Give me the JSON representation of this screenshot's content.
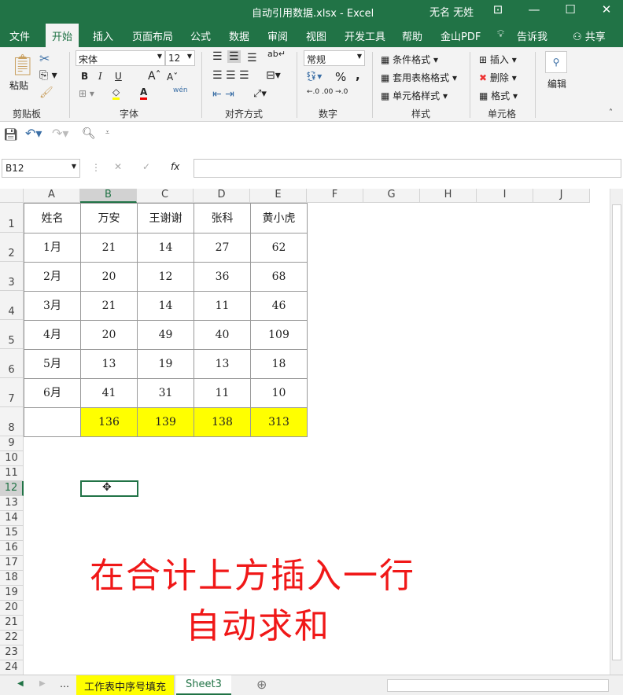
{
  "title": "自动引用数据.xlsx  -  Excel",
  "user": "无名 无姓",
  "menu_tabs": [
    "文件",
    "开始",
    "插入",
    "页面布局",
    "公式",
    "数据",
    "审阅",
    "视图",
    "开发工具",
    "帮助",
    "金山PDF",
    "告诉我",
    "共享"
  ],
  "ribbon": {
    "paste": "粘贴",
    "clipboard": "剪贴板",
    "font_name": "宋体",
    "font_size": "12",
    "bold": "B",
    "italic": "I",
    "underline": "U",
    "font_group": "字体",
    "phonetic": "wén",
    "align_group": "对齐方式",
    "number_format": "常规",
    "percent": "%",
    "comma": ",",
    "number_group": "数字",
    "cond_format": "条件格式",
    "table_format": "套用表格格式",
    "cell_style": "单元格样式",
    "styles_group": "样式",
    "insert": "插入",
    "delete": "删除",
    "format": "格式",
    "cells_group": "单元格",
    "edit": "编辑"
  },
  "name_box": "B12",
  "formula_value": "",
  "columns": [
    "A",
    "B",
    "C",
    "D",
    "E",
    "F",
    "G",
    "H",
    "I",
    "J"
  ],
  "rows": [
    "1",
    "2",
    "3",
    "4",
    "5",
    "6",
    "7",
    "8",
    "9",
    "10",
    "11",
    "12",
    "13",
    "14",
    "15",
    "16",
    "17",
    "18",
    "19",
    "20",
    "21",
    "22",
    "23",
    "24"
  ],
  "table": [
    [
      "姓名",
      "万安",
      "王谢谢",
      "张科",
      "黄小虎"
    ],
    [
      "1月",
      "21",
      "14",
      "27",
      "62"
    ],
    [
      "2月",
      "20",
      "12",
      "36",
      "68"
    ],
    [
      "3月",
      "21",
      "14",
      "11",
      "46"
    ],
    [
      "4月",
      "20",
      "49",
      "40",
      "109"
    ],
    [
      "5月",
      "13",
      "19",
      "13",
      "18"
    ],
    [
      "6月",
      "41",
      "31",
      "11",
      "10"
    ],
    [
      "",
      "136",
      "139",
      "138",
      "313"
    ]
  ],
  "highlight_color": "#ffff00",
  "overlay": {
    "line1": "在合计上方插入一行",
    "line2": "自动求和"
  },
  "sheets": [
    "工作表中序号填充",
    "Sheet3"
  ],
  "active_sheet": "Sheet3"
}
